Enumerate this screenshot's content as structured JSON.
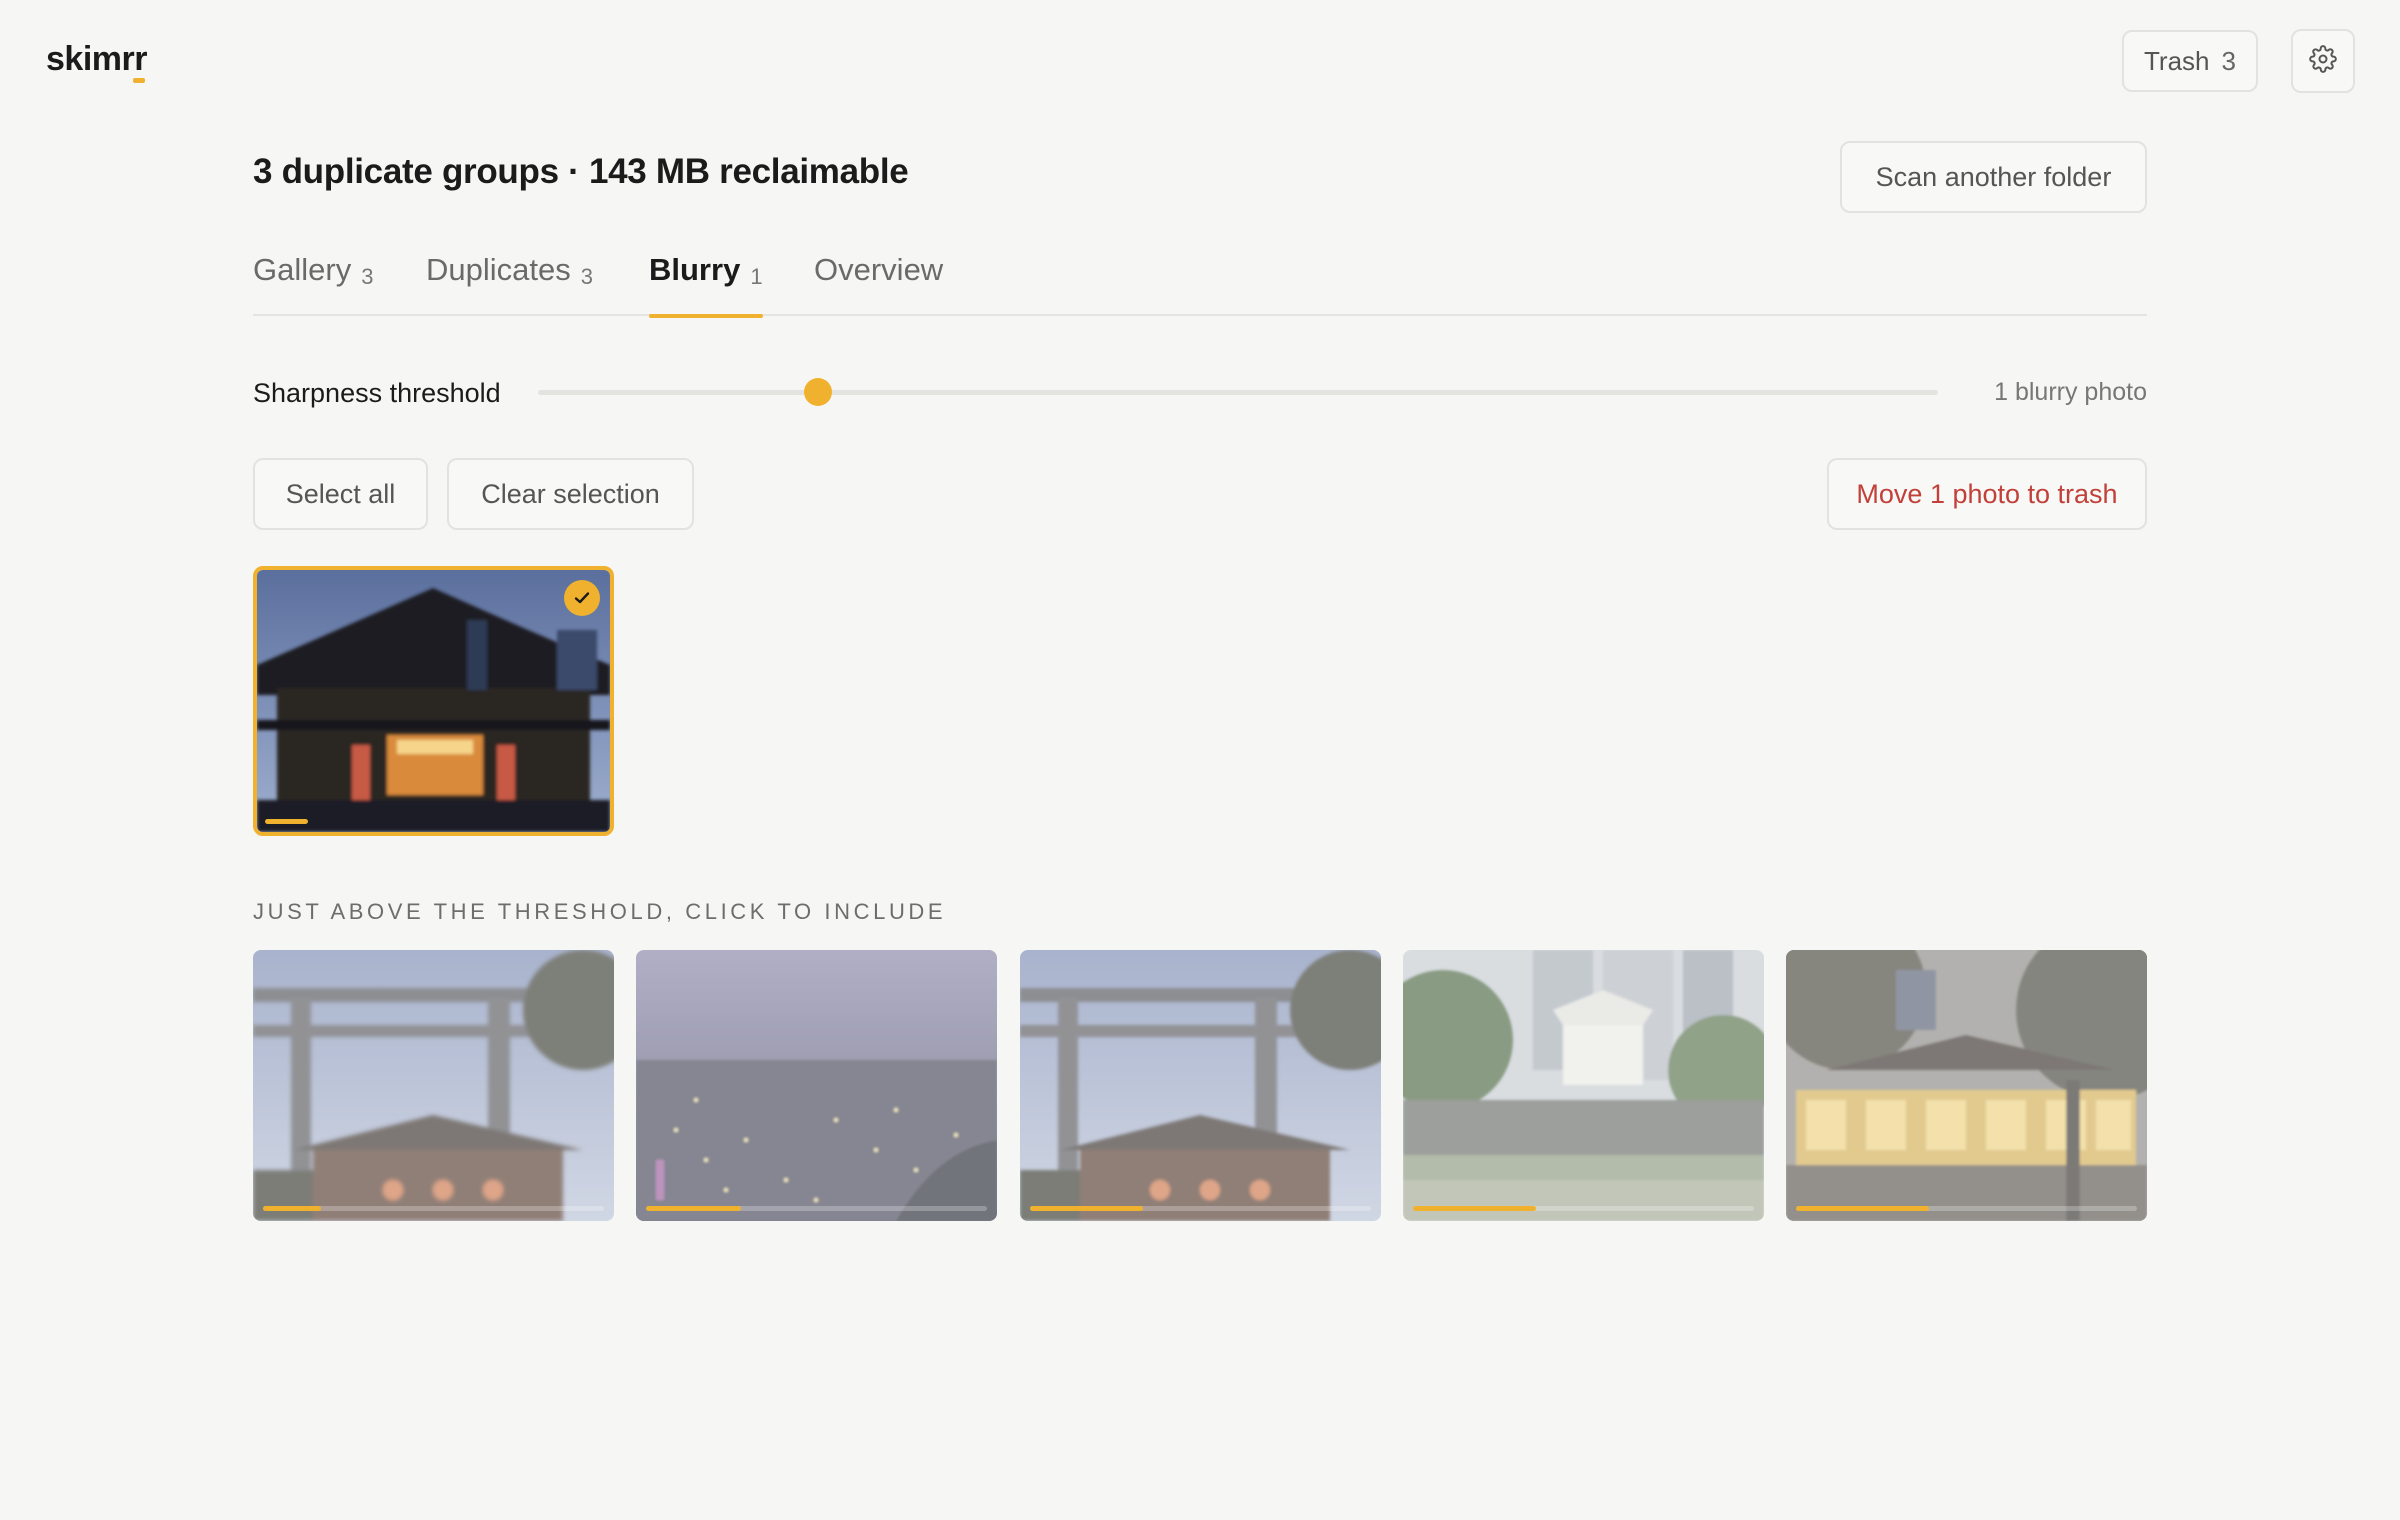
{
  "app": {
    "logo": "skimrr"
  },
  "topbar": {
    "trash_label": "Trash",
    "trash_count": "3",
    "settings_icon": "gear-icon"
  },
  "header": {
    "title": "3 duplicate groups · 143 MB reclaimable",
    "scan_button": "Scan another folder"
  },
  "tabs": [
    {
      "label": "Gallery",
      "count": "3",
      "active": false
    },
    {
      "label": "Duplicates",
      "count": "3",
      "active": false
    },
    {
      "label": "Blurry",
      "count": "1",
      "active": true
    },
    {
      "label": "Overview",
      "count": "",
      "active": false
    }
  ],
  "threshold": {
    "label": "Sharpness threshold",
    "value_fraction": 0.2,
    "result_text": "1 blurry photo"
  },
  "actions": {
    "select_all": "Select all",
    "clear_selection": "Clear selection",
    "move_to_trash": "Move 1 photo to trash"
  },
  "blurry_photos": [
    {
      "subject": "temple facade at night",
      "selected": true,
      "sharpness": 0.12
    }
  ],
  "near_threshold": {
    "heading": "JUST ABOVE THE THRESHOLD, CLICK TO INCLUDE",
    "photos": [
      {
        "subject": "torii gate with shrine",
        "sharpness": 0.17
      },
      {
        "subject": "city skyline at dusk",
        "sharpness": 0.28
      },
      {
        "subject": "torii gate with shrine",
        "sharpness": 0.33
      },
      {
        "subject": "castle turret by moat",
        "sharpness": 0.36
      },
      {
        "subject": "lantern-lit shrine hall",
        "sharpness": 0.39
      }
    ]
  },
  "colors": {
    "accent": "#f0b22e",
    "danger": "#c2403a",
    "background": "#f6f6f4"
  }
}
